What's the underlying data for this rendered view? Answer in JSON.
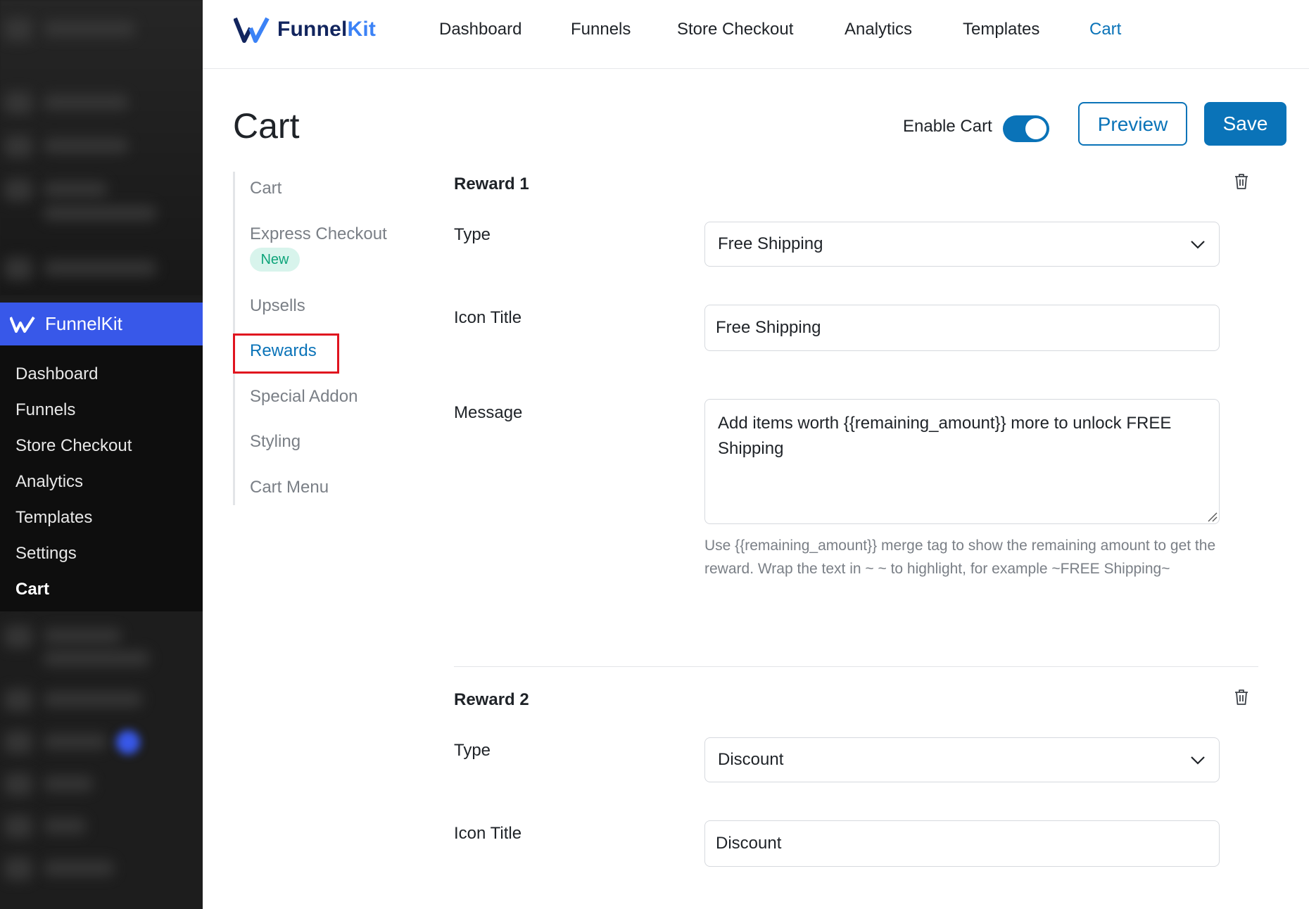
{
  "brand": {
    "name_main": "Funnel",
    "name_accent": "Kit"
  },
  "topnav": {
    "items": [
      "Dashboard",
      "Funnels",
      "Store Checkout",
      "Analytics",
      "Templates",
      "Cart"
    ],
    "active": "Cart"
  },
  "wp_menu": {
    "plugin_title": "FunnelKit",
    "items": [
      "Dashboard",
      "Funnels",
      "Store Checkout",
      "Analytics",
      "Templates",
      "Settings",
      "Cart"
    ],
    "active": "Cart"
  },
  "page": {
    "title": "Cart",
    "enable_label": "Enable Cart",
    "enable_on": true,
    "preview_label": "Preview",
    "save_label": "Save"
  },
  "subnav": {
    "items": [
      "Cart",
      "Express Checkout",
      "Upsells",
      "Rewards",
      "Special Addon",
      "Styling",
      "Cart Menu"
    ],
    "new_badge": "New",
    "active": "Rewards"
  },
  "rewards": [
    {
      "title": "Reward 1",
      "type_label": "Type",
      "type_value": "Free Shipping",
      "icon_title_label": "Icon Title",
      "icon_title_value": "Free Shipping",
      "message_label": "Message",
      "message_value": "Add items worth {{remaining_amount}} more to unlock FREE Shipping",
      "help_text": "Use {{remaining_amount}} merge tag to show the remaining amount to get the reward. Wrap the text in ~ ~ to highlight, for example ~FREE Shipping~"
    },
    {
      "title": "Reward 2",
      "type_label": "Type",
      "type_value": "Discount",
      "icon_title_label": "Icon Title",
      "icon_title_value": "Discount"
    }
  ],
  "colors": {
    "accent": "#0a73b8",
    "wp_brand": "#3858e9",
    "badge_bg": "#d8f4ec",
    "badge_text": "#0ea47a",
    "highlight": "#e0141f"
  }
}
